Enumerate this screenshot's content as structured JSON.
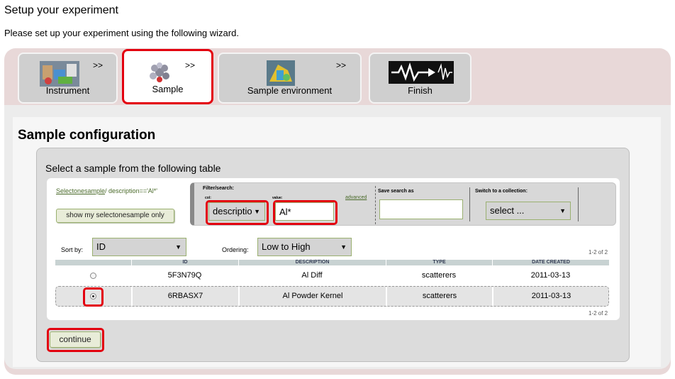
{
  "header": {
    "title": "Setup your experiment",
    "intro": "Please set up your experiment using the following wizard."
  },
  "wizard": {
    "tabs": [
      {
        "label": "Instrument",
        "arrows": ">>",
        "icon": "instrument-icon"
      },
      {
        "label": "Sample",
        "arrows": ">>",
        "icon": "molecule-icon"
      },
      {
        "label": "Sample environment",
        "arrows": ">>",
        "icon": "sample-environment-icon"
      },
      {
        "label": "Finish",
        "icon": "finish-logo"
      }
    ],
    "active_tab": "Sample"
  },
  "config": {
    "title": "Sample configuration",
    "prompt": "Select a sample from the following table",
    "breadcrumb_link": "Selectonesample",
    "breadcrumb_rest": "/ description=='Al*'",
    "show_mine_label": "show my selectonesample only",
    "filter": {
      "title": "Filter/search:",
      "col_label": "col:",
      "col_value": "descriptio",
      "value_label": "value:",
      "value": "Al*",
      "advanced": "advanced"
    },
    "save_search": {
      "label": "Save search as",
      "value": ""
    },
    "collection": {
      "label": "Switch to a collection:",
      "value": "select ..."
    },
    "sort": {
      "label": "Sort by:",
      "value": "ID"
    },
    "ordering": {
      "label": "Ordering:",
      "value": "Low to High"
    },
    "pager_top": "1-2 of 2",
    "pager_bottom": "1-2 of 2",
    "columns": [
      "",
      "ID",
      "DESCRIPTION",
      "TYPE",
      "DATE CREATED"
    ],
    "rows": [
      {
        "id": "5F3N79Q",
        "description": "Al Diff",
        "type": "scatterers",
        "date": "2011-03-13",
        "selected": false
      },
      {
        "id": "6RBASX7",
        "description": "Al Powder Kernel",
        "type": "scatterers",
        "date": "2011-03-13",
        "selected": true
      }
    ],
    "continue_label": "continue"
  },
  "colors": {
    "highlight": "#e3000f",
    "accent_green": "#9ab070",
    "wizard_bg": "#e8d8d8"
  }
}
